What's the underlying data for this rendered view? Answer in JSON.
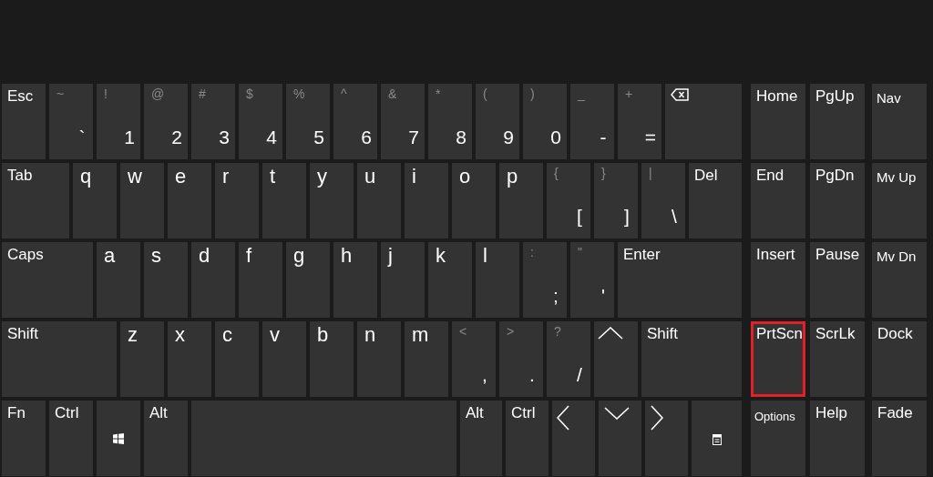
{
  "keyboard": {
    "number_row": [
      {
        "kind": "label",
        "label": "Esc"
      },
      {
        "kind": "symbol",
        "shift": "~",
        "main": "`"
      },
      {
        "kind": "symbol",
        "shift": "!",
        "main": "1"
      },
      {
        "kind": "symbol",
        "shift": "@",
        "main": "2"
      },
      {
        "kind": "symbol",
        "shift": "#",
        "main": "3"
      },
      {
        "kind": "symbol",
        "shift": "$",
        "main": "4"
      },
      {
        "kind": "symbol",
        "shift": "%",
        "main": "5"
      },
      {
        "kind": "symbol",
        "shift": "^",
        "main": "6"
      },
      {
        "kind": "symbol",
        "shift": "&",
        "main": "7"
      },
      {
        "kind": "symbol",
        "shift": "*",
        "main": "8"
      },
      {
        "kind": "symbol",
        "shift": "(",
        "main": "9"
      },
      {
        "kind": "symbol",
        "shift": ")",
        "main": "0"
      },
      {
        "kind": "symbol",
        "shift": "_",
        "main": "-"
      },
      {
        "kind": "symbol",
        "shift": "+",
        "main": "="
      },
      {
        "kind": "backspace"
      }
    ],
    "top_row": [
      {
        "kind": "label",
        "label": "Tab"
      },
      {
        "kind": "letter",
        "label": "q"
      },
      {
        "kind": "letter",
        "label": "w"
      },
      {
        "kind": "letter",
        "label": "e"
      },
      {
        "kind": "letter",
        "label": "r"
      },
      {
        "kind": "letter",
        "label": "t"
      },
      {
        "kind": "letter",
        "label": "y"
      },
      {
        "kind": "letter",
        "label": "u"
      },
      {
        "kind": "letter",
        "label": "i"
      },
      {
        "kind": "letter",
        "label": "o"
      },
      {
        "kind": "letter",
        "label": "p"
      },
      {
        "kind": "symbol",
        "shift": "{",
        "main": "["
      },
      {
        "kind": "symbol",
        "shift": "}",
        "main": "]"
      },
      {
        "kind": "symbol",
        "shift": "|",
        "main": "\\"
      },
      {
        "kind": "label",
        "label": "Del"
      }
    ],
    "home_row": [
      {
        "kind": "label",
        "label": "Caps"
      },
      {
        "kind": "letter",
        "label": "a"
      },
      {
        "kind": "letter",
        "label": "s"
      },
      {
        "kind": "letter",
        "label": "d"
      },
      {
        "kind": "letter",
        "label": "f"
      },
      {
        "kind": "letter",
        "label": "g"
      },
      {
        "kind": "letter",
        "label": "h"
      },
      {
        "kind": "letter",
        "label": "j"
      },
      {
        "kind": "letter",
        "label": "k"
      },
      {
        "kind": "letter",
        "label": "l"
      },
      {
        "kind": "symbol",
        "shift": ":",
        "main": ";"
      },
      {
        "kind": "symbol",
        "shift": "\"",
        "main": "'"
      },
      {
        "kind": "label",
        "label": "Enter"
      }
    ],
    "bottom_row": [
      {
        "kind": "label",
        "label": "Shift"
      },
      {
        "kind": "letter",
        "label": "z"
      },
      {
        "kind": "letter",
        "label": "x"
      },
      {
        "kind": "letter",
        "label": "c"
      },
      {
        "kind": "letter",
        "label": "v"
      },
      {
        "kind": "letter",
        "label": "b"
      },
      {
        "kind": "letter",
        "label": "n"
      },
      {
        "kind": "letter",
        "label": "m"
      },
      {
        "kind": "symbol",
        "shift": "<",
        "main": ","
      },
      {
        "kind": "symbol",
        "shift": ">",
        "main": "."
      },
      {
        "kind": "symbol",
        "shift": "?",
        "main": "/"
      },
      {
        "kind": "up"
      },
      {
        "kind": "label",
        "label": "Shift"
      }
    ],
    "control_row": [
      {
        "kind": "label",
        "label": "Fn"
      },
      {
        "kind": "label",
        "label": "Ctrl"
      },
      {
        "kind": "start"
      },
      {
        "kind": "label",
        "label": "Alt"
      },
      {
        "kind": "space"
      },
      {
        "kind": "label",
        "label": "Alt"
      },
      {
        "kind": "label",
        "label": "Ctrl"
      },
      {
        "kind": "left"
      },
      {
        "kind": "down"
      },
      {
        "kind": "right"
      },
      {
        "kind": "menu"
      }
    ]
  },
  "nav_keys": {
    "rows": [
      [
        {
          "kind": "label",
          "label": "Home",
          "highlighted": false
        },
        {
          "kind": "label",
          "label": "PgUp",
          "highlighted": false
        },
        {
          "kind": "minor",
          "label": "Nav",
          "highlighted": false
        }
      ],
      [
        {
          "kind": "label",
          "label": "End",
          "highlighted": false
        },
        {
          "kind": "label",
          "label": "PgDn",
          "highlighted": false
        },
        {
          "kind": "minor",
          "label": "Mv Up",
          "highlighted": false
        }
      ],
      [
        {
          "kind": "label",
          "label": "Insert",
          "highlighted": false
        },
        {
          "kind": "label",
          "label": "Pause",
          "highlighted": false
        },
        {
          "kind": "minor",
          "label": "Mv Dn",
          "highlighted": false
        }
      ],
      [
        {
          "kind": "label",
          "label": "PrtScn",
          "highlighted": true
        },
        {
          "kind": "label",
          "label": "ScrLk",
          "highlighted": false
        },
        {
          "kind": "label",
          "label": "Dock",
          "highlighted": false
        }
      ],
      [
        {
          "kind": "tiny",
          "label": "Options",
          "highlighted": false
        },
        {
          "kind": "label",
          "label": "Help",
          "highlighted": false
        },
        {
          "kind": "label",
          "label": "Fade",
          "highlighted": false
        }
      ]
    ]
  }
}
